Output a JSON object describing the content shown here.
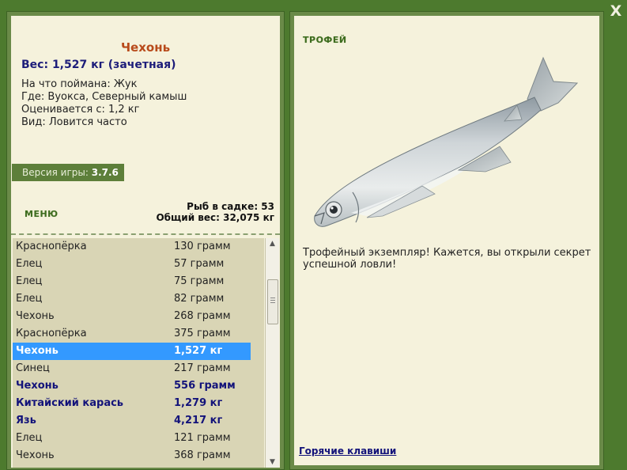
{
  "window": {
    "close_label": "X"
  },
  "fish": {
    "title": "Чехонь",
    "weight_line": "Вес: 1,527 кг (зачетная)",
    "bait": "На что поймана: Жук",
    "location": "Где: Вуокса, Северный камыш",
    "valuation": "Оценивается с: 1,2 кг",
    "species_note": "Вид: Ловится часто"
  },
  "version": {
    "label": "Версия игры:",
    "value": "3.7.6"
  },
  "menu_label": "МЕНЮ",
  "stats": {
    "keepnet": "Рыб в садке: 53",
    "total_weight": "Общий вес: 32,075 кг"
  },
  "catch_list": [
    {
      "name": "Краснопёрка",
      "weight": "130 грамм",
      "trophy": false,
      "selected": false
    },
    {
      "name": "Елец",
      "weight": "57 грамм",
      "trophy": false,
      "selected": false
    },
    {
      "name": "Елец",
      "weight": "75 грамм",
      "trophy": false,
      "selected": false
    },
    {
      "name": "Елец",
      "weight": "82 грамм",
      "trophy": false,
      "selected": false
    },
    {
      "name": "Чехонь",
      "weight": "268 грамм",
      "trophy": false,
      "selected": false
    },
    {
      "name": "Краснопёрка",
      "weight": "375 грамм",
      "trophy": false,
      "selected": false
    },
    {
      "name": "Чехонь",
      "weight": "1,527 кг",
      "trophy": true,
      "selected": true
    },
    {
      "name": "Синец",
      "weight": "217 грамм",
      "trophy": false,
      "selected": false
    },
    {
      "name": "Чехонь",
      "weight": "556 грамм",
      "trophy": true,
      "selected": false
    },
    {
      "name": "Китайский карась",
      "weight": "1,279 кг",
      "trophy": true,
      "selected": false
    },
    {
      "name": "Язь",
      "weight": "4,217 кг",
      "trophy": true,
      "selected": false
    },
    {
      "name": "Елец",
      "weight": "121 грамм",
      "trophy": false,
      "selected": false
    },
    {
      "name": "Чехонь",
      "weight": "368 грамм",
      "trophy": false,
      "selected": false
    }
  ],
  "trophy_panel": {
    "label": "ТРОФЕЙ",
    "image_icon": "sabrefish-photo",
    "description": "Трофейный экземпляр! Кажется, вы открыли секрет успешной ловли!",
    "hotkeys_link": "Горячие клавиши"
  },
  "colors": {
    "background": "#4d7a2e",
    "panel": "#f5f2dc",
    "list_bg": "#d9d5b5",
    "selection": "#3399ff",
    "fish_title": "#b84a1a",
    "trophy_text": "#13137a"
  }
}
